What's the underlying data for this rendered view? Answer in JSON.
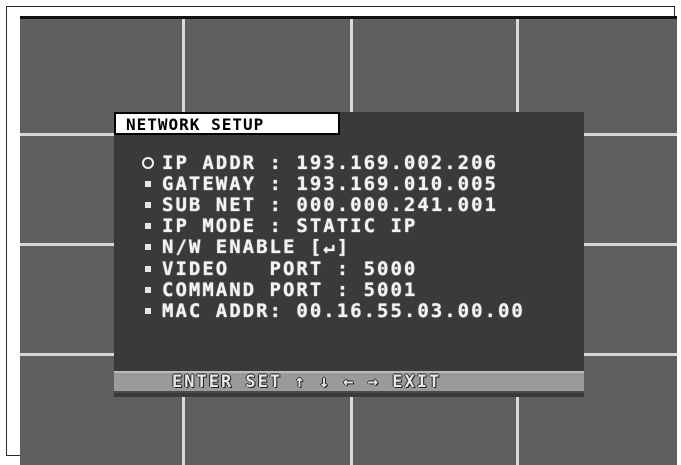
{
  "panel": {
    "title": "NETWORK SETUP"
  },
  "menu_items": [
    {
      "marker": "circle-icon",
      "label": "IP ADDR : 193.169.002.206"
    },
    {
      "marker": "square-bullet-icon",
      "label": "GATEWAY : 193.169.010.005"
    },
    {
      "marker": "square-bullet-icon",
      "label": "SUB NET : 000.000.241.001"
    },
    {
      "marker": "square-bullet-icon",
      "label": "IP MODE : STATIC IP"
    },
    {
      "marker": "square-bullet-icon",
      "label": "N/W ENABLE [↵]"
    },
    {
      "marker": "square-bullet-icon",
      "label": "VIDEO   PORT : 5000"
    },
    {
      "marker": "square-bullet-icon",
      "label": "COMMAND PORT : 5001"
    },
    {
      "marker": "square-bullet-icon",
      "label": "MAC ADDR: 00.16.55.03.00.00"
    }
  ],
  "footer": {
    "hint": "ENTER SET ↑ ↓ ← → EXIT"
  },
  "colors": {
    "panel_background": "#3a3a3a",
    "screen_background": "#5f5f5f",
    "text": "#f3f3f3",
    "title_background": "#ffffff",
    "footer_background": "#9a9a9a"
  }
}
